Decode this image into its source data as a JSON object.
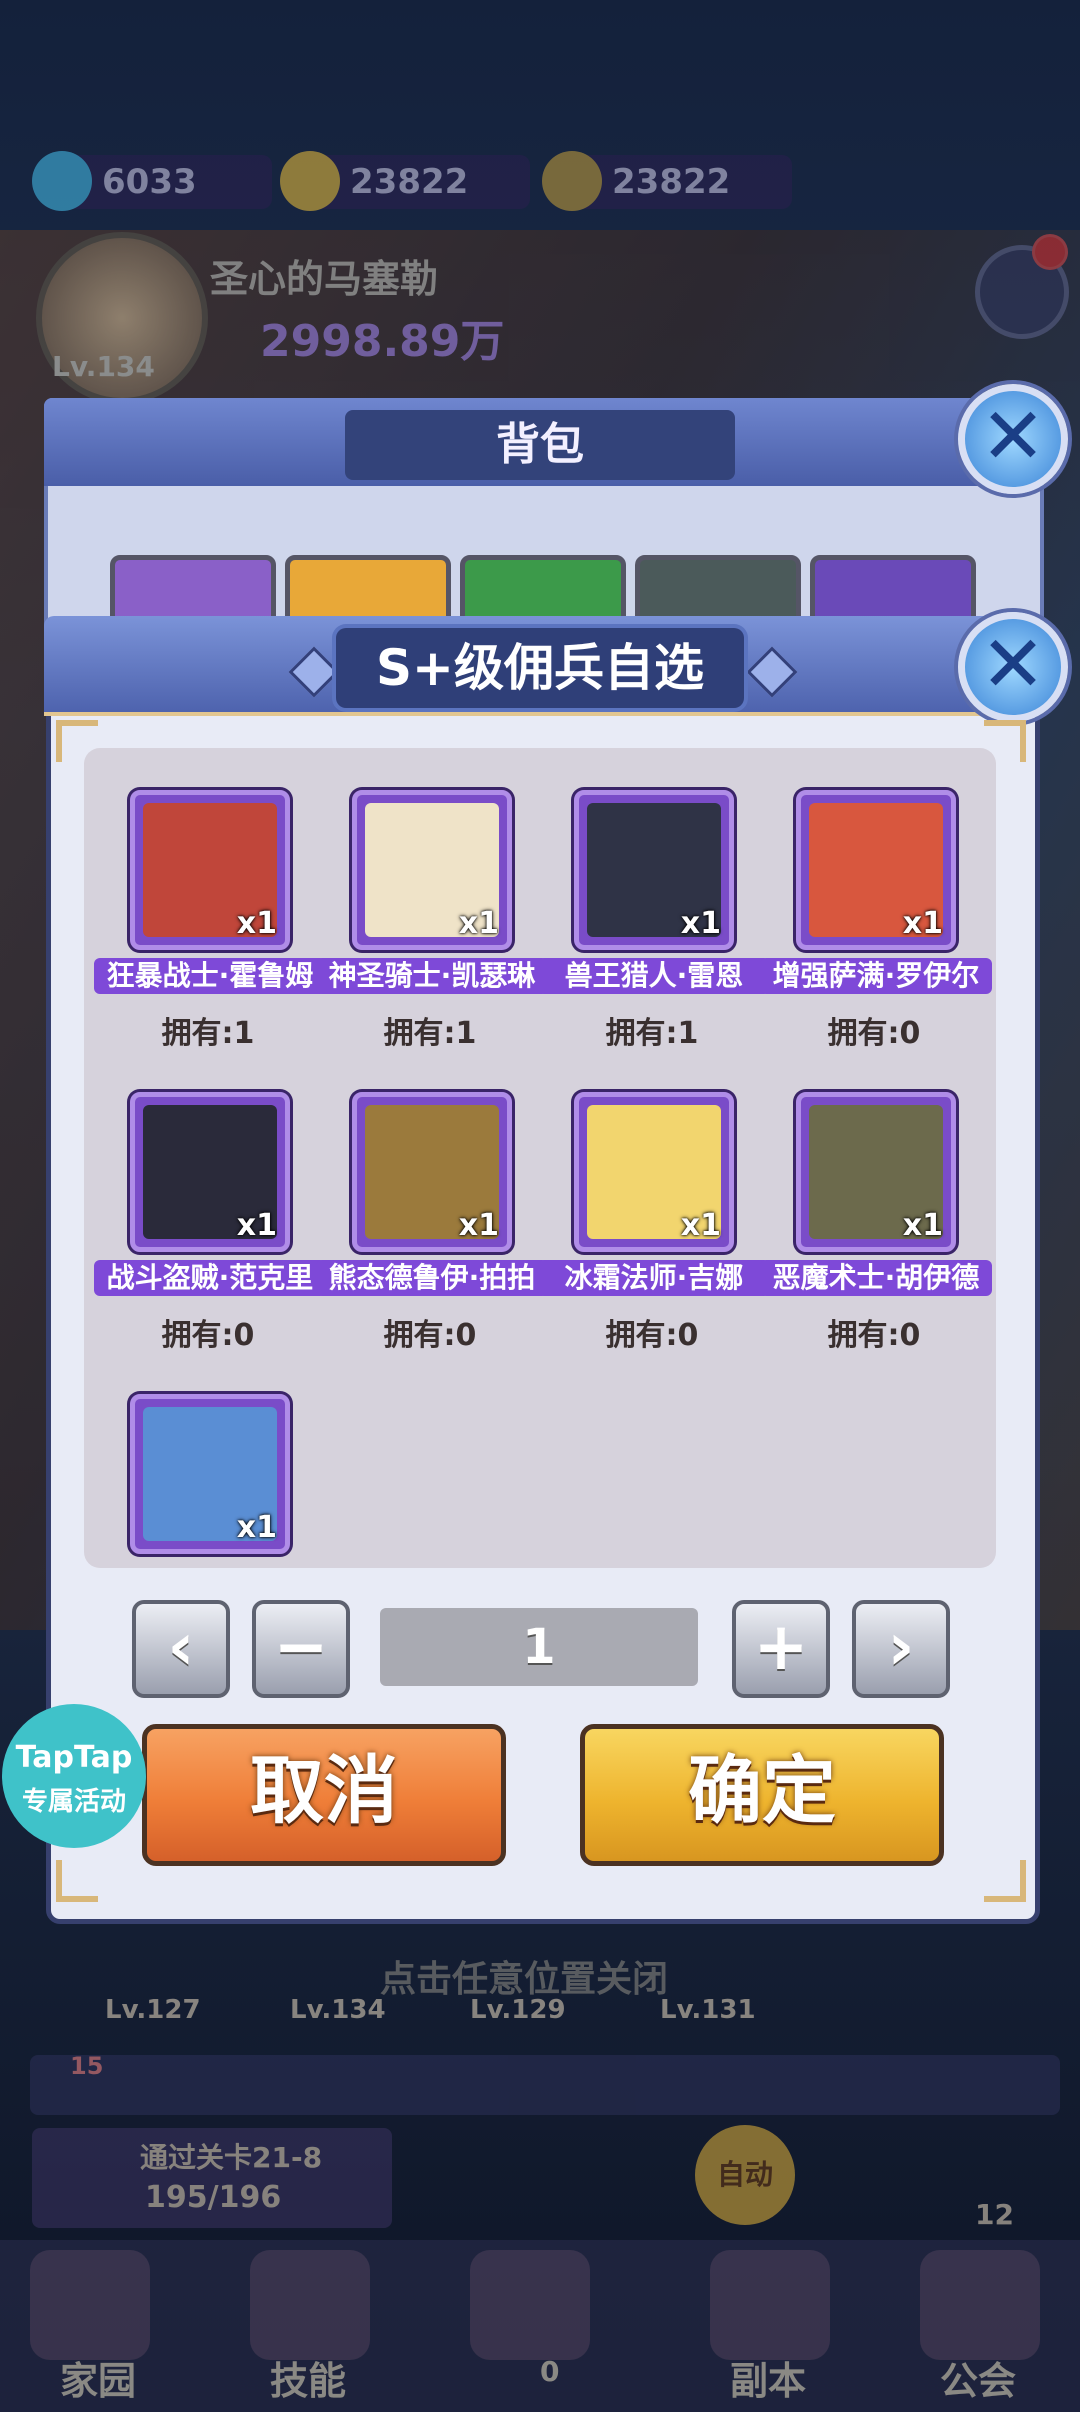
{
  "background": {
    "resources": [
      {
        "icon": "diamond-icon",
        "value": "6033",
        "color": "#46c3f0"
      },
      {
        "icon": "gold-coin-icon",
        "value": "23822",
        "color": "#f0c23a"
      },
      {
        "icon": "gold-coin-icon",
        "value": "23822",
        "color": "#c9a23a"
      }
    ],
    "player": {
      "name": "圣心的马塞勒",
      "power": "2998.89万",
      "level": "Lv.134"
    },
    "bag_title": "背包",
    "close_hint": "点击任意位置关闭",
    "stage": {
      "label": "通过关卡21-8",
      "progress": "195/196"
    },
    "auto_label": "自动",
    "chat_count": "15",
    "level_count": "12",
    "bottom_levels": [
      "Lv.127",
      "Lv.134",
      "Lv.129",
      "Lv.131"
    ],
    "bottom_nav": [
      "家园",
      "技能",
      "0",
      "副本",
      "公会"
    ]
  },
  "dialog": {
    "title": "S+级佣兵自选",
    "own_prefix": "拥有:",
    "items": [
      {
        "name": "狂暴战士·霍鲁姆",
        "qty": "x1",
        "owned": "拥有:1",
        "color": "#c0463a"
      },
      {
        "name": "神圣骑士·凯瑟琳",
        "qty": "x1",
        "owned": "拥有:1",
        "color": "#efe3c8"
      },
      {
        "name": "兽王猎人·雷恩",
        "qty": "x1",
        "owned": "拥有:1",
        "color": "#2f3346"
      },
      {
        "name": "增强萨满·罗伊尔",
        "qty": "x1",
        "owned": "拥有:0",
        "color": "#d8573e"
      },
      {
        "name": "战斗盗贼·范克里",
        "qty": "x1",
        "owned": "拥有:0",
        "color": "#2a2a3a"
      },
      {
        "name": "熊态德鲁伊·拍拍",
        "qty": "x1",
        "owned": "拥有:0",
        "color": "#9b7a3c"
      },
      {
        "name": "冰霜法师·吉娜",
        "qty": "x1",
        "owned": "拥有:0",
        "color": "#f2d56e"
      },
      {
        "name": "恶魔术士·胡伊德",
        "qty": "x1",
        "owned": "拥有:0",
        "color": "#6c6a4c"
      },
      {
        "name": "",
        "qty": "x1",
        "owned": "",
        "color": "#5a8ed4"
      }
    ],
    "quantity": "1",
    "cancel_label": "取消",
    "confirm_label": "确定"
  },
  "taptap": {
    "line1": "TapTap",
    "line2": "专属活动"
  }
}
